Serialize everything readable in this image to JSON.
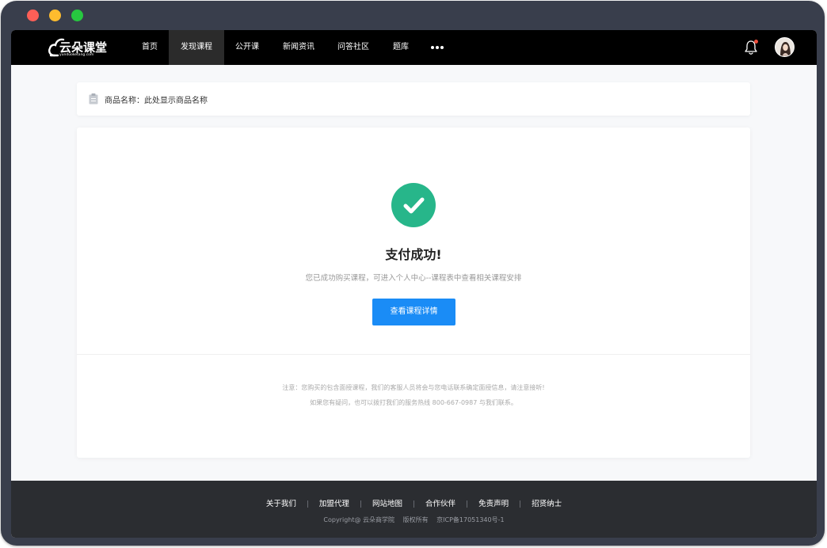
{
  "window": {
    "controls": [
      "close",
      "minimize",
      "maximize"
    ]
  },
  "header": {
    "logo": {
      "name": "云朵课堂",
      "domain": "yunduoketang.com"
    },
    "nav": [
      {
        "label": "首页",
        "active": false
      },
      {
        "label": "发现课程",
        "active": true
      },
      {
        "label": "公开课",
        "active": false
      },
      {
        "label": "新闻资讯",
        "active": false
      },
      {
        "label": "问答社区",
        "active": false
      },
      {
        "label": "题库",
        "active": false
      }
    ],
    "more_icon": "more-horizontal-icon",
    "bell_icon": "bell-icon",
    "has_notification": true
  },
  "product": {
    "icon": "clipboard-icon",
    "label": "商品名称：",
    "value": "此处显示商品名称"
  },
  "result": {
    "icon": "check-circle-icon",
    "title": "支付成功!",
    "description": "您已成功购买课程，可进入个人中心--课程表中查看相关课程安排",
    "button_label": "查看课程详情",
    "note_line1": "注意：您购买的包含面授课程，我们的客服人员将会与您电话联系确定面授信息，请注意接听!",
    "note_line2": "如果您有疑问，也可以拨打我们的服务热线 800-667-0987 与我们联系。"
  },
  "footer": {
    "links": [
      "关于我们",
      "加盟代理",
      "网站地图",
      "合作伙伴",
      "免责声明",
      "招贤纳士"
    ],
    "separator": "|",
    "copyright": "Copyright@ 云朵商学院",
    "rights": "版权所有",
    "icp": "京ICP备17051340号-1"
  },
  "colors": {
    "nav_bg": "#000000",
    "accent_blue": "#1a8cf6",
    "success_green": "#27b68a",
    "footer_bg": "#2b2d31",
    "notification_dot": "#f04e3c"
  }
}
